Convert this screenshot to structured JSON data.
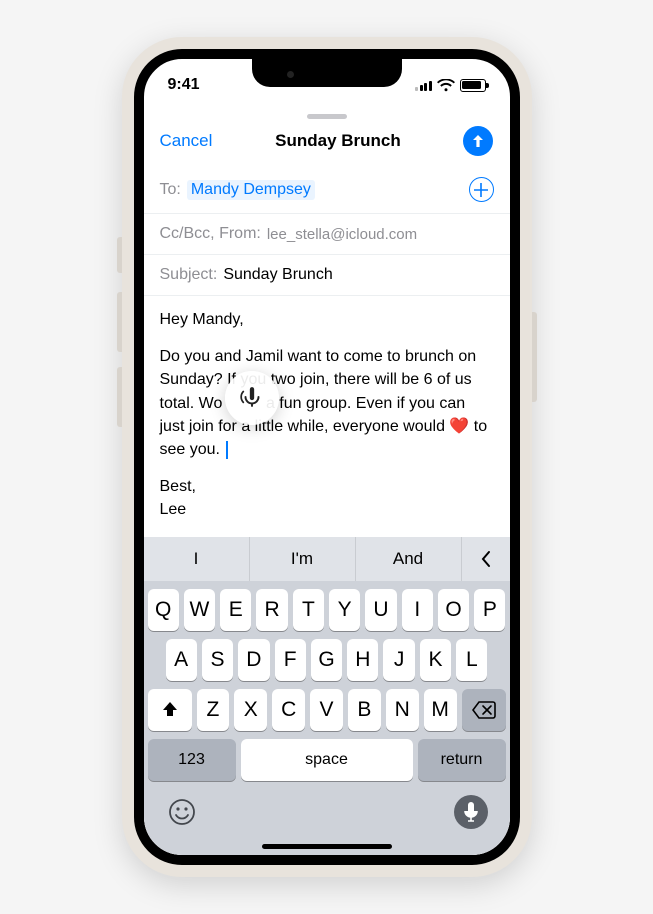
{
  "status": {
    "time": "9:41"
  },
  "nav": {
    "cancel": "Cancel",
    "title": "Sunday Brunch"
  },
  "to": {
    "label": "To:",
    "recipient": "Mandy Dempsey"
  },
  "ccbcc": {
    "label": "Cc/Bcc, From:",
    "from_email": "lee_stella@icloud.com"
  },
  "subject": {
    "label": "Subject:",
    "value": "Sunday Brunch"
  },
  "body": {
    "greeting": "Hey Mandy,",
    "p1_a": "Do you and Jamil want to come to brunch on Sunday? If you two join, there will be 6 of us total. Wo",
    "p1_b": "a fun group. Even if you can just join for a little while, everyone would ",
    "p1_c": " to see you. ",
    "heart": "❤️",
    "signoff1": "Best,",
    "signoff2": "Lee"
  },
  "predictive": {
    "w1": "I",
    "w2": "I'm",
    "w3": "And"
  },
  "keyboard": {
    "row1": [
      "Q",
      "W",
      "E",
      "R",
      "T",
      "Y",
      "U",
      "I",
      "O",
      "P"
    ],
    "row2": [
      "A",
      "S",
      "D",
      "F",
      "G",
      "H",
      "J",
      "K",
      "L"
    ],
    "row3": [
      "Z",
      "X",
      "C",
      "V",
      "B",
      "N",
      "M"
    ],
    "num": "123",
    "space": "space",
    "return": "return"
  }
}
